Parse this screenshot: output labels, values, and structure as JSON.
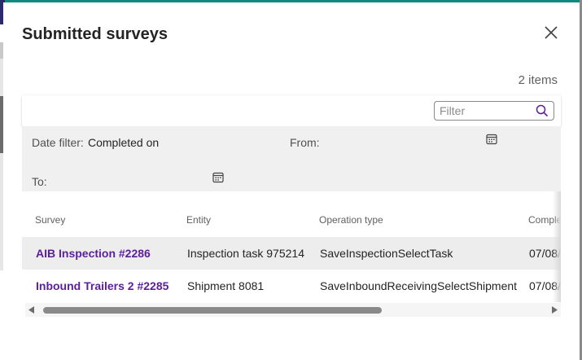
{
  "dialog": {
    "title": "Submitted surveys",
    "item_count": "2 items",
    "filter_placeholder": "Filter",
    "date_filter_label": "Date filter:",
    "date_filter_value": "Completed on",
    "from_label": "From:",
    "to_label": "To:"
  },
  "table": {
    "columns": [
      "Survey",
      "Entity",
      "Operation type",
      "Comple"
    ],
    "rows": [
      [
        "AIB Inspection #2286",
        "Inspection task 975214",
        "SaveInspectionSelectTask",
        "07/08/"
      ],
      [
        "Inbound Trailers 2 #2285",
        "Shipment 8081",
        "SaveInboundReceivingSelectShipment",
        "07/08/"
      ]
    ]
  },
  "icons": {
    "close": "close-icon",
    "search": "search-icon",
    "calendar": "calendar-icon",
    "scroll_left": "caret-left-icon",
    "scroll_right": "caret-right-icon"
  },
  "colors": {
    "link": "#5c1e99",
    "search_icon": "#5c1e99",
    "accent_strip": "#0f8a7e",
    "row_selected": "#ededed",
    "filter_panel": "#f0f0f0"
  }
}
